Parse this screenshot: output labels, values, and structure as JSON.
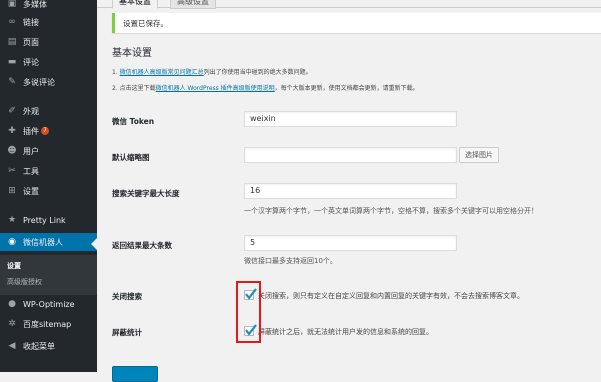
{
  "sidebar": {
    "items": [
      {
        "icon": "media-icon",
        "glyph": "▣",
        "label": "多媒体"
      },
      {
        "icon": "link-icon",
        "glyph": "∞",
        "label": "链接"
      },
      {
        "icon": "page-icon",
        "glyph": "▤",
        "label": "页面"
      },
      {
        "icon": "comment-icon",
        "glyph": "▬",
        "label": "评论"
      },
      {
        "icon": "multi-comment-icon",
        "glyph": "✎",
        "label": "多说评论"
      },
      {
        "icon": "appearance-icon",
        "glyph": "✐",
        "label": "外观"
      },
      {
        "icon": "plugin-icon",
        "glyph": "✚",
        "label": "插件",
        "badge": "7"
      },
      {
        "icon": "user-icon",
        "glyph": "☻",
        "label": "用户"
      },
      {
        "icon": "tools-icon",
        "glyph": "✂",
        "label": "工具"
      },
      {
        "icon": "settings-icon",
        "glyph": "⊞",
        "label": "设置"
      },
      {
        "icon": "pretty-link-icon",
        "glyph": "★",
        "label": "Pretty Link"
      },
      {
        "icon": "wechat-robot-icon",
        "glyph": "◉",
        "label": "微信机器人",
        "active": true
      },
      {
        "icon": "wp-optimize-icon",
        "glyph": "●",
        "label": "WP-Optimize"
      },
      {
        "icon": "baidu-sitemap-icon",
        "glyph": "✲",
        "label": "百度sitemap"
      },
      {
        "icon": "collapse-menu-icon",
        "glyph": "◀",
        "label": "收起菜单"
      }
    ],
    "submenu": [
      {
        "label": "设置",
        "current": true
      },
      {
        "label": "高级版授权",
        "current": false
      }
    ]
  },
  "tabs": [
    "基本设置",
    "高级设置"
  ],
  "notice": "设置已保存。",
  "section_title": "基本设置",
  "notes": [
    {
      "prefix": "1. ",
      "link": "微信机器人高级版常见问题汇总",
      "suffix": "列出了你使用当中碰到的绝大多数问题。"
    },
    {
      "prefix": "2. 点击这里下载",
      "link": "微信机器人 WordPress 插件高级版使用说明",
      "suffix": "，每个大版本更新，使用文档都会更新，请重新下载。"
    }
  ],
  "fields": {
    "token": {
      "label": "微信 Token",
      "value": "weixin"
    },
    "thumbnail": {
      "label": "默认缩略图",
      "value": "",
      "button": "选择图片"
    },
    "keyword_max": {
      "label": "搜索关键字最大长度",
      "value": "16",
      "desc": "一个汉字算两个字节，一个英文单词算两个字节，空格不算，搜索多个关键字可以用空格分开！"
    },
    "result_max": {
      "label": "返回结果最大条数",
      "value": "5",
      "desc": "微信接口最多支持返回10个。"
    },
    "close_search": {
      "label": "关闭搜索",
      "checked": true,
      "text": "关闭搜索，则只有定义在自定义回复和内置回复的关键字有效，不会去搜索博客文章。"
    },
    "hide_stats": {
      "label": "屏蔽统计",
      "checked": true,
      "text": "屏蔽统计之后，就无法统计用户发的信息和系统的回复。"
    }
  },
  "colors": {
    "sidebar_bg": "#23282d",
    "active": "#0073aa",
    "highlight": "#e3191b",
    "notice_border": "#7ad03a"
  }
}
